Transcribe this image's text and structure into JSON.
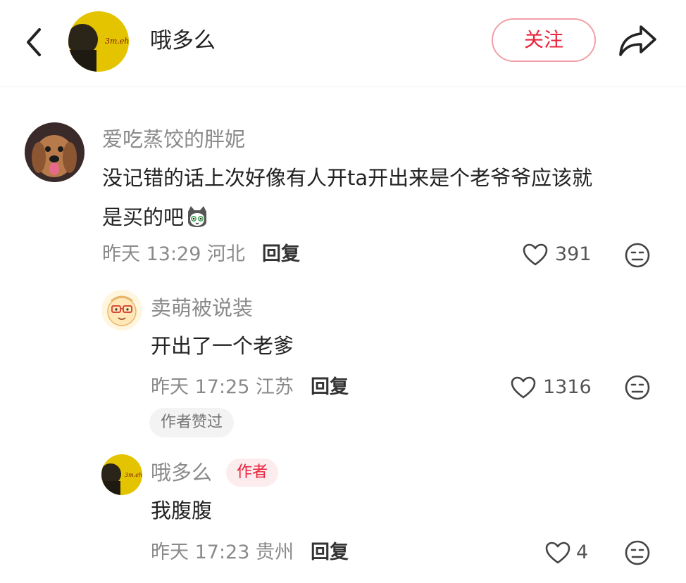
{
  "header": {
    "author_name": "哦多么",
    "follow_label": "关注",
    "avatar_text": "3m.eh"
  },
  "comments": [
    {
      "user": "爱吃蒸饺的胖妮",
      "text_line1": "没记错的话上次好像有人开ta开出来是个老爷爷应该就",
      "text_line2": "是买的吧",
      "time": "昨天 13:29",
      "location": "河北",
      "reply_label": "回复",
      "likes": "391"
    },
    {
      "user": "卖萌被说装",
      "text": "开出了一个老爹",
      "time": "昨天 17:25",
      "location": "江苏",
      "reply_label": "回复",
      "likes": "1316",
      "badge": "作者赞过"
    },
    {
      "user": "哦多么",
      "author_badge": "作者",
      "text": "我腹腹",
      "time": "昨天 17:23",
      "location": "贵州",
      "reply_label": "回复",
      "likes": "4"
    }
  ],
  "colors": {
    "accent": "#e8243c",
    "muted_text": "#8a8a8a"
  }
}
